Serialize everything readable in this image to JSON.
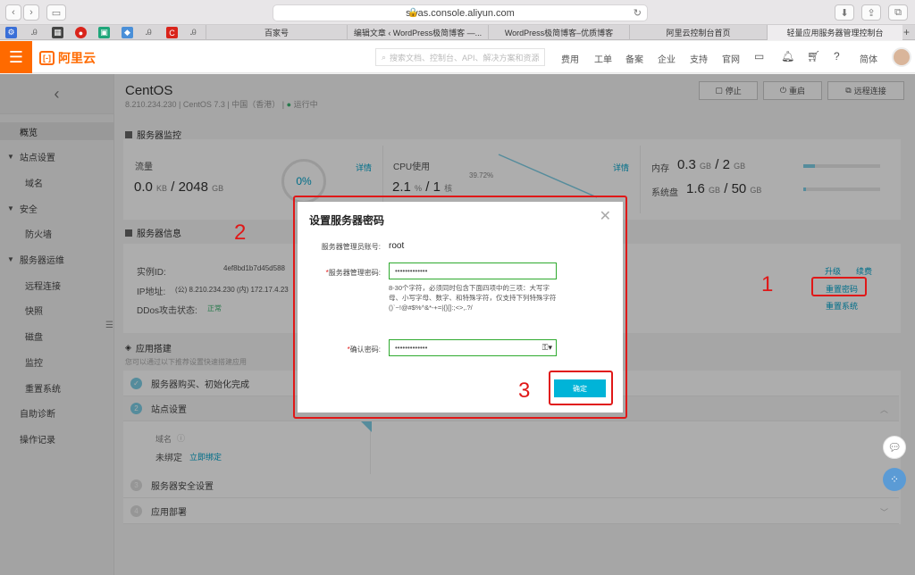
{
  "browser": {
    "url": "swas.console.aliyun.com",
    "tabs": [
      "百家号",
      "编辑文章 ‹ WordPress极简博客 —...",
      "WordPress极简博客–优质博客",
      "阿里云控制台首页",
      "轻量应用服务器管理控制台"
    ]
  },
  "topbar": {
    "logo": "阿里云",
    "search_placeholder": "搜索文档、控制台、API、解决方案和资源",
    "nav": [
      "费用",
      "工单",
      "备案",
      "企业",
      "支持",
      "官网"
    ],
    "lang": "简体"
  },
  "sidebar": {
    "items": [
      {
        "label": "概览",
        "type": "item",
        "active": true
      },
      {
        "label": "站点设置",
        "type": "group"
      },
      {
        "label": "域名",
        "type": "sub"
      },
      {
        "label": "安全",
        "type": "group"
      },
      {
        "label": "防火墙",
        "type": "sub"
      },
      {
        "label": "服务器运维",
        "type": "group"
      },
      {
        "label": "远程连接",
        "type": "sub"
      },
      {
        "label": "快照",
        "type": "sub"
      },
      {
        "label": "磁盘",
        "type": "sub"
      },
      {
        "label": "监控",
        "type": "sub"
      },
      {
        "label": "重置系统",
        "type": "sub"
      },
      {
        "label": "自助诊断",
        "type": "item"
      },
      {
        "label": "操作记录",
        "type": "item"
      }
    ]
  },
  "server": {
    "name": "CentOS",
    "subtitle": "8.210.234.230 | CentOS 7.3 | 中国（香港） |",
    "status": "运行中",
    "buttons": {
      "stop": "停止",
      "restart": "重启",
      "remote": "远程连接"
    }
  },
  "monitor": {
    "heading": "服务器监控",
    "traffic_label": "流量",
    "traffic_used": "0.0",
    "traffic_used_unit": "KB",
    "traffic_total": "2048",
    "traffic_total_unit": "GB",
    "traffic_percent": "0%",
    "detail": "详情",
    "cpu_label": "CPU使用",
    "cpu_peak": "39.72%",
    "cpu_value": "2.1",
    "cpu_unit": "%",
    "cpu_cores": "1",
    "cpu_cores_unit": "核",
    "memory_label": "内存",
    "memory_used": "0.3",
    "memory_total": "2",
    "memory_unit": "GB",
    "memory_fraction": 0.15,
    "disk_label": "系统盘",
    "disk_used": "1.6",
    "disk_total": "50",
    "disk_unit": "GB",
    "disk_fraction": 0.03
  },
  "info": {
    "heading": "服务器信息",
    "instance_label": "实例ID:",
    "instance_value": "4ef8bd1b7d45d588",
    "ip_label": "IP地址:",
    "ip_value": "(公) 8.210.234.230 (内) 172.17.4.23",
    "ddos_label": "DDos攻击状态:",
    "ddos_value": "正常",
    "upgrade": "升级",
    "renew": "续费",
    "reset_password": "重置密码",
    "reset_system": "重置系统"
  },
  "app": {
    "heading": "应用搭建",
    "desc": "您可以通过以下推荐设置快速搭建应用",
    "steps": [
      "服务器购买、初始化完成",
      "站点设置",
      "服务器安全设置",
      "应用部署"
    ],
    "domain_label": "域名",
    "unbound": "未绑定",
    "bind_now": "立即绑定"
  },
  "modal": {
    "title": "设置服务器密码",
    "admin_label": "服务器管理员账号:",
    "admin_value": "root",
    "password_label": "服务器管理密码:",
    "password_value": "•••••••••••••",
    "hint": "8-30个字符，必须同时包含下面四项中的三项：大写字母、小写字母、数字、和特殊字符，仅支持下列特殊字符 ()`~!@#$%^&*-+=|{}[]:;<>,.?/",
    "confirm_label": "确认密码:",
    "confirm_value": "•••••••••••••",
    "ok": "确定"
  },
  "annotations": {
    "a1": "1",
    "a2": "2",
    "a3": "3"
  }
}
